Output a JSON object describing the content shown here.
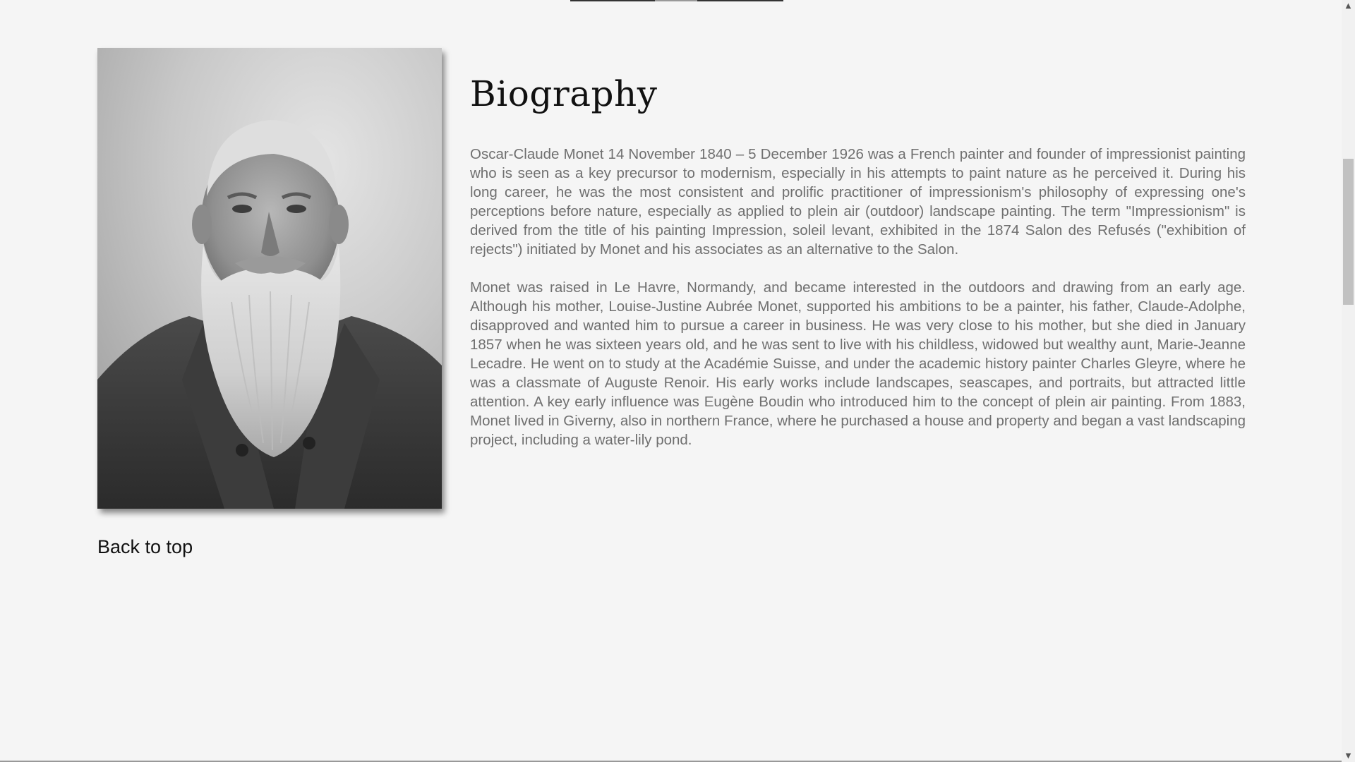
{
  "biography": {
    "title": "Biography",
    "portrait_alt": "Claude Monet portrait",
    "paragraphs": [
      "Oscar-Claude Monet 14 November 1840 – 5 December 1926 was a French painter and founder of impressionist painting who is seen as a key precursor to modernism, especially in his attempts to paint nature as he perceived it. During his long career, he was the most consistent and prolific practitioner of impressionism's philosophy of expressing one's perceptions before nature, especially as applied to plein air (outdoor) landscape painting. The term \"Impressionism\" is derived from the title of his painting Impression, soleil levant, exhibited in the 1874 Salon des Refusés (\"exhibition of rejects\") initiated by Monet and his associates as an alternative to the Salon.",
      "Monet was raised in Le Havre, Normandy, and became interested in the outdoors and drawing from an early age. Although his mother, Louise-Justine Aubrée Monet, supported his ambitions to be a painter, his father, Claude-Adolphe, disapproved and wanted him to pursue a career in business. He was very close to his mother, but she died in January 1857 when he was sixteen years old, and he was sent to live with his childless, widowed but wealthy aunt, Marie-Jeanne Lecadre. He went on to study at the Académie Suisse, and under the academic history painter Charles Gleyre, where he was a classmate of Auguste Renoir. His early works include landscapes, seascapes, and portraits, but attracted little attention. A key early influence was Eugène Boudin who introduced him to the concept of plein air painting. From 1883, Monet lived in Giverny, also in northern France, where he purchased a house and property and began a vast landscaping project, including a water-lily pond."
    ]
  },
  "navigation": {
    "back_to_top": "Back to top"
  },
  "scrollbar": {
    "up_icon": "arrow-up-icon",
    "down_icon": "arrow-down-icon",
    "position_fraction": 0.21
  },
  "colors": {
    "background": "#f5f5f5",
    "body_text": "#6f6f6f",
    "heading": "#111111"
  }
}
